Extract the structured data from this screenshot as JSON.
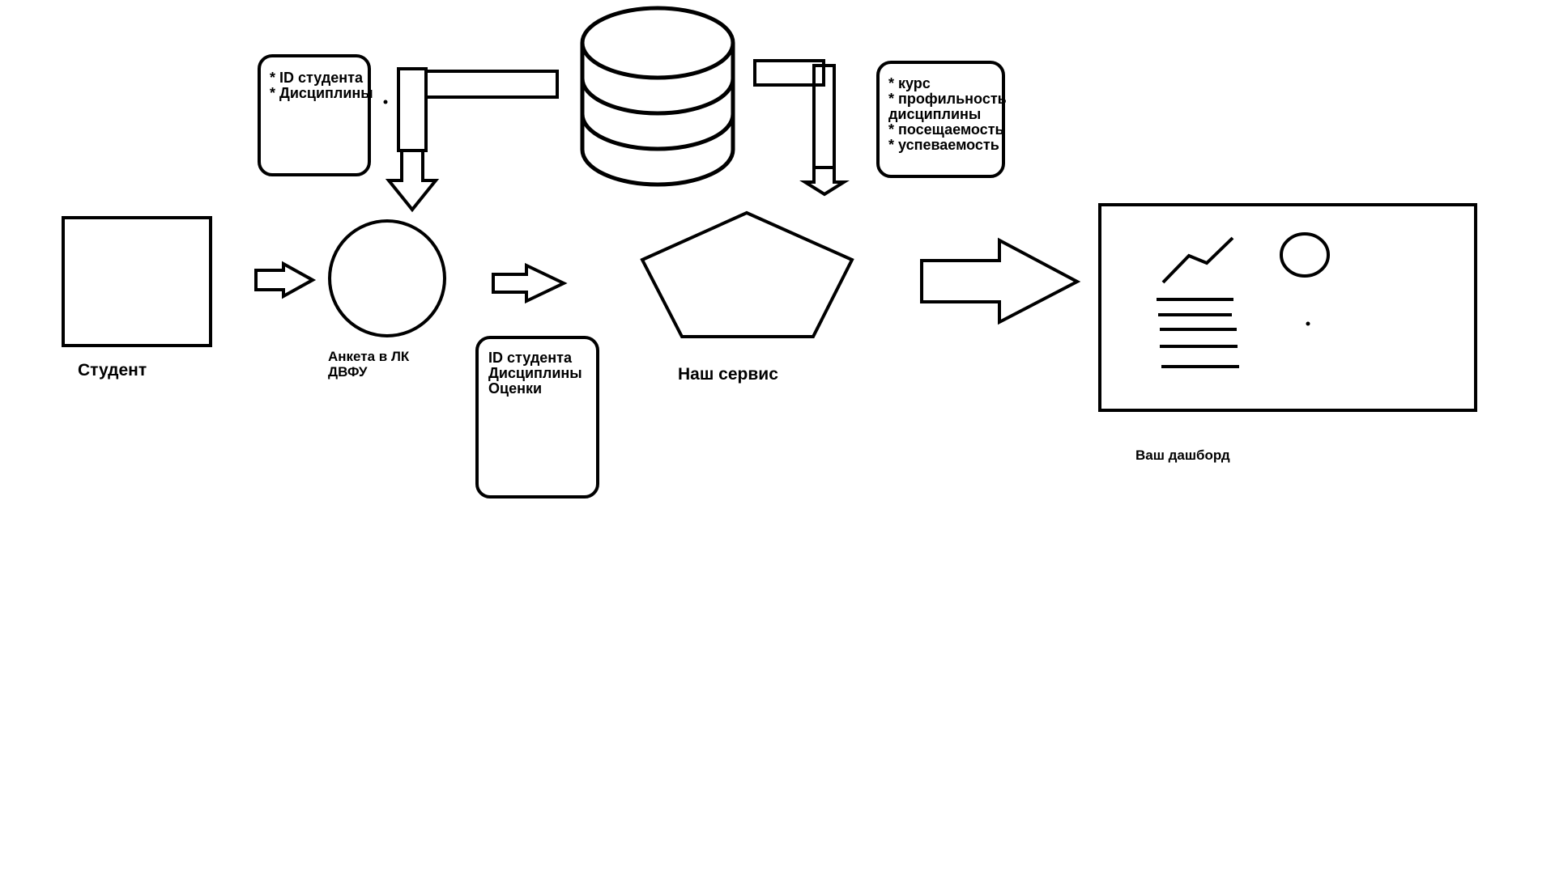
{
  "colors": {
    "stroke": "#000000",
    "background": "#ffffff"
  },
  "nodes": {
    "student": {
      "label": "Студент"
    },
    "questionnaire": {
      "label_lines": [
        "Анкета в ЛК",
        "ДВФУ"
      ]
    },
    "service": {
      "label": "Наш сервис"
    },
    "dashboard": {
      "label": "Ваш дашборд"
    }
  },
  "notes": {
    "db_to_questionnaire": [
      "* ID студента",
      "* Дисциплины"
    ],
    "db_to_service": [
      "* курс",
      "* профильность",
      "дисциплины",
      "* посещаемость",
      "* успеваемость"
    ],
    "questionnaire_to_service": [
      "ID студента",
      "Дисциплины",
      "Оценки"
    ]
  }
}
